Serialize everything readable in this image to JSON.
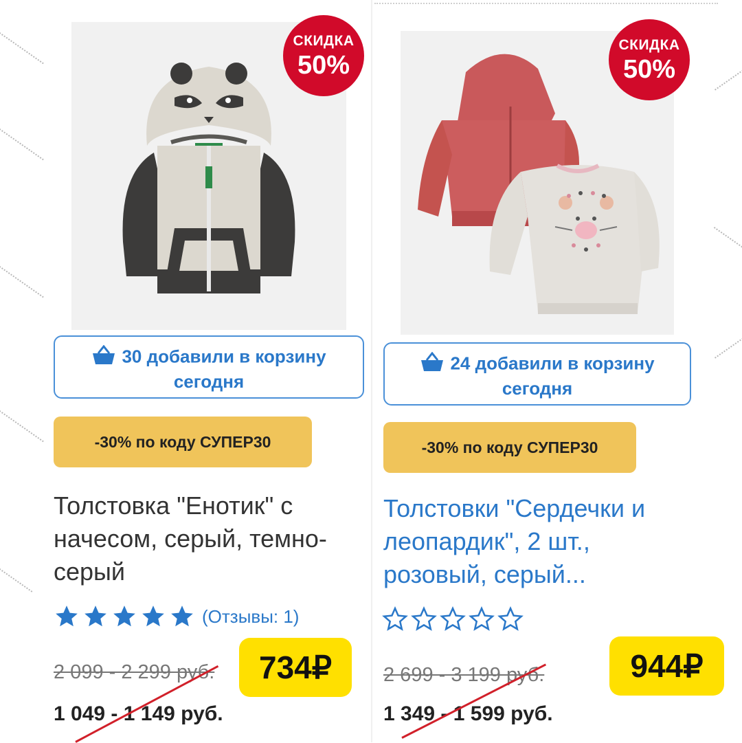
{
  "products": [
    {
      "badge_line1": "СКИДКА",
      "badge_line2": "50%",
      "cart_line1": "30 добавили в корзину",
      "cart_line2": "сегодня",
      "promo": "-30% по коду СУПЕР30",
      "title": "Толстовка \"Енотик\" с начесом, серый, темно-серый",
      "title_color": "#333333",
      "rating": 5,
      "reviews": "(Отзывы: 1)",
      "old_price": "2 099 - 2 299 руб.",
      "new_price": "1 049 - 1 149 руб.",
      "sale_price": "734₽"
    },
    {
      "badge_line1": "СКИДКА",
      "badge_line2": "50%",
      "cart_line1": "24 добавили в корзину",
      "cart_line2": "сегодня",
      "promo": "-30% по коду СУПЕР30",
      "title": "Толстовки \"Сердечки и леопардик\", 2 шт., розовый, серый...",
      "title_color": "#2a78c9",
      "rating": 0,
      "reviews": "",
      "old_price": "2 699 - 3 199 руб.",
      "new_price": "1 349 - 1 599 руб.",
      "sale_price": "944₽"
    }
  ],
  "icons": {
    "cart": "basket-icon",
    "star": "star-icon"
  },
  "colors": {
    "badge": "#d10a2a",
    "accent": "#2a78c9",
    "promo": "#f0c45a",
    "sale": "#ffe000",
    "slash": "#d1202a"
  }
}
